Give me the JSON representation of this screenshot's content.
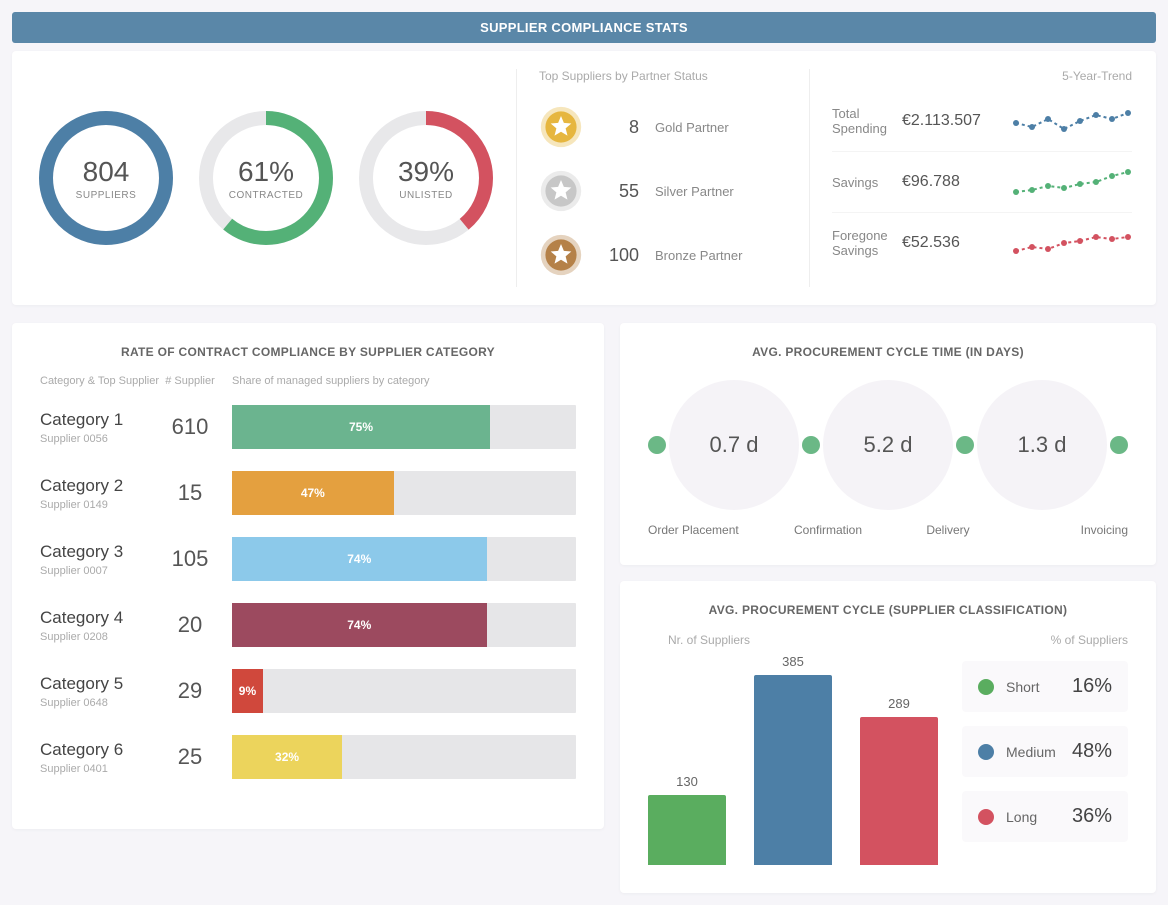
{
  "header": {
    "title": "SUPPLIER COMPLIANCE STATS"
  },
  "donuts": [
    {
      "value": "804",
      "label": "SUPPLIERS",
      "pct": 100,
      "color": "#4d7fa6",
      "bg": "#e8e8ea"
    },
    {
      "value": "61%",
      "label": "CONTRACTED",
      "pct": 61,
      "color": "#54b177",
      "bg": "#e8e8ea"
    },
    {
      "value": "39%",
      "label": "UNLISTED",
      "pct": 39,
      "color": "#d35260",
      "bg": "#e8e8ea"
    }
  ],
  "partners": {
    "title": "Top Suppliers by Partner Status",
    "rows": [
      {
        "count": "8",
        "label": "Gold Partner",
        "color": "#e6b63f"
      },
      {
        "count": "55",
        "label": "Silver Partner",
        "color": "#c7c7c7"
      },
      {
        "count": "100",
        "label": "Bronze Partner",
        "color": "#b58148"
      }
    ]
  },
  "trends": {
    "title": "5-Year-Trend",
    "rows": [
      {
        "label": "Total Spending",
        "value": "€2.113.507",
        "color": "#4d7fa6",
        "points": [
          18,
          22,
          14,
          24,
          16,
          10,
          14,
          8
        ]
      },
      {
        "label": "Savings",
        "value": "€96.788",
        "color": "#54b177",
        "points": [
          26,
          24,
          20,
          22,
          18,
          16,
          10,
          6
        ]
      },
      {
        "label": "Foregone Savings",
        "value": "€52.536",
        "color": "#d35260",
        "points": [
          24,
          20,
          22,
          16,
          14,
          10,
          12,
          10
        ]
      }
    ]
  },
  "compliance": {
    "title": "RATE OF CONTRACT COMPLIANCE BY SUPPLIER CATEGORY",
    "hdr": {
      "c1": "Category & Top Supplier",
      "c2": "# Supplier",
      "c3": "Share of managed suppliers by category"
    },
    "rows": [
      {
        "name": "Category 1",
        "sup": "Supplier 0056",
        "n": "610",
        "pct": 75,
        "label": "75%",
        "color": "#6bb48f"
      },
      {
        "name": "Category 2",
        "sup": "Supplier 0149",
        "n": "15",
        "pct": 47,
        "label": "47%",
        "color": "#e4a03f"
      },
      {
        "name": "Category 3",
        "sup": "Supplier 0007",
        "n": "105",
        "pct": 74,
        "label": "74%",
        "color": "#8cc9ea"
      },
      {
        "name": "Category 4",
        "sup": "Supplier 0208",
        "n": "20",
        "pct": 74,
        "label": "74%",
        "color": "#9c4a5f"
      },
      {
        "name": "Category 5",
        "sup": "Supplier 0648",
        "n": "29",
        "pct": 9,
        "label": "9%",
        "color": "#d0483c"
      },
      {
        "name": "Category 6",
        "sup": "Supplier 0401",
        "n": "25",
        "pct": 32,
        "label": "32%",
        "color": "#ecd45c"
      }
    ]
  },
  "cycle": {
    "title": "AVG. PROCUREMENT CYCLE TIME (IN DAYS)",
    "stages": [
      {
        "label": "Order Placement"
      },
      {
        "value": "0.7 d"
      },
      {
        "label": "Confirmation"
      },
      {
        "value": "5.2 d"
      },
      {
        "label": "Delivery"
      },
      {
        "value": "1.3 d"
      },
      {
        "label": "Invoicing"
      }
    ],
    "labels": [
      "Order Placement",
      "Confirmation",
      "Delivery",
      "Invoicing"
    ]
  },
  "classification": {
    "title": "AVG. PROCUREMENT CYCLE (SUPPLIER CLASSIFICATION)",
    "bars_title": "Nr. of Suppliers",
    "legend_title": "% of Suppliers",
    "bars": [
      {
        "value": "130",
        "h": 70,
        "color": "#5aad5f"
      },
      {
        "value": "385",
        "h": 190,
        "color": "#4d7fa6"
      },
      {
        "value": "289",
        "h": 148,
        "color": "#d35260"
      }
    ],
    "legend": [
      {
        "name": "Short",
        "pct": "16%",
        "color": "#5aad5f"
      },
      {
        "name": "Medium",
        "pct": "48%",
        "color": "#4d7fa6"
      },
      {
        "name": "Long",
        "pct": "36%",
        "color": "#d35260"
      }
    ]
  },
  "chart_data": [
    {
      "type": "bar",
      "title": "Rate of Contract Compliance by Supplier Category",
      "xlabel": "Category",
      "ylabel": "Share of managed suppliers (%)",
      "categories": [
        "Category 1",
        "Category 2",
        "Category 3",
        "Category 4",
        "Category 5",
        "Category 6"
      ],
      "values": [
        75,
        47,
        74,
        74,
        9,
        32
      ],
      "meta_supplier_count": [
        610,
        15,
        105,
        20,
        29,
        25
      ],
      "meta_top_supplier": [
        "Supplier 0056",
        "Supplier 0149",
        "Supplier 0007",
        "Supplier 0208",
        "Supplier 0648",
        "Supplier 0401"
      ],
      "ylim": [
        0,
        100
      ]
    },
    {
      "type": "bar",
      "title": "Avg. Procurement Cycle (Supplier Classification) — Nr. of Suppliers",
      "categories": [
        "Short",
        "Medium",
        "Long"
      ],
      "values": [
        130,
        385,
        289
      ],
      "percentages": [
        16,
        48,
        36
      ]
    },
    {
      "type": "line",
      "title": "5-Year-Trend (sparklines, relative)",
      "series": [
        {
          "name": "Total Spending",
          "current": 2113507,
          "trend_index": [
            18,
            22,
            14,
            24,
            16,
            10,
            14,
            8
          ]
        },
        {
          "name": "Savings",
          "current": 96788,
          "trend_index": [
            26,
            24,
            20,
            22,
            18,
            16,
            10,
            6
          ]
        },
        {
          "name": "Foregone Savings",
          "current": 52536,
          "trend_index": [
            24,
            20,
            22,
            16,
            14,
            10,
            12,
            10
          ]
        }
      ]
    },
    {
      "type": "table",
      "title": "Avg. Procurement Cycle Time (days)",
      "categories": [
        "Order→Confirmation",
        "Confirmation→Delivery",
        "Delivery→Invoicing"
      ],
      "values": [
        0.7,
        5.2,
        1.3
      ]
    },
    {
      "type": "pie",
      "title": "Supplier Contract Status",
      "categories": [
        "Contracted",
        "Unlisted"
      ],
      "values": [
        61,
        39
      ],
      "total_suppliers": 804
    },
    {
      "type": "table",
      "title": "Top Suppliers by Partner Status",
      "categories": [
        "Gold Partner",
        "Silver Partner",
        "Bronze Partner"
      ],
      "values": [
        8,
        55,
        100
      ]
    }
  ]
}
